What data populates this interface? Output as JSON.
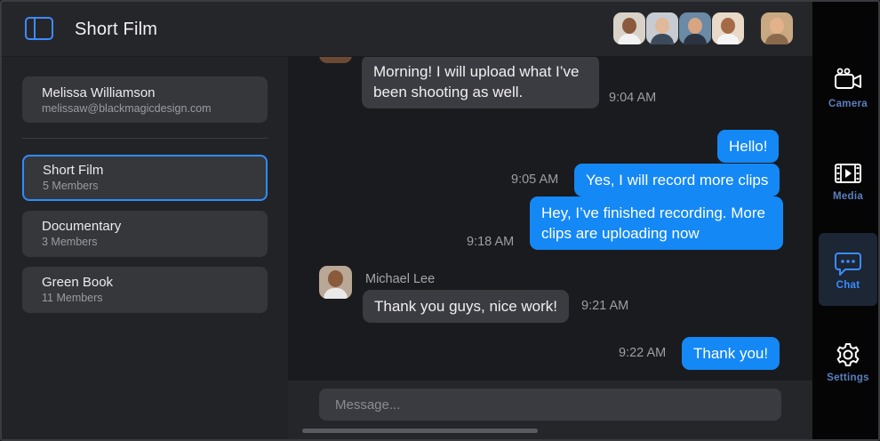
{
  "header": {
    "title": "Short Film",
    "participants": [
      {
        "name": "participant-1",
        "skin": "#8a5a3c",
        "shirt": "#f2f2f2",
        "bg": "#d9d2c9"
      },
      {
        "name": "participant-2",
        "skin": "#e0b89a",
        "shirt": "#3d4a5c",
        "bg": "#c7ccd3"
      },
      {
        "name": "participant-3",
        "skin": "#d7a582",
        "shirt": "#2a3342",
        "bg": "#6a8aa6"
      },
      {
        "name": "participant-4",
        "skin": "#a56a46",
        "shirt": "#f5f5f5",
        "bg": "#e8d9c8"
      }
    ],
    "self_avatar": {
      "skin": "#e3b28c",
      "shirt": "#8a6a4a",
      "bg": "#c9a982"
    }
  },
  "user": {
    "name": "Melissa Williamson",
    "email": "melissaw@blackmagicdesign.com"
  },
  "groups": [
    {
      "name": "Short Film",
      "members": "5 Members",
      "active": true
    },
    {
      "name": "Documentary",
      "members": "3 Members",
      "active": false
    },
    {
      "name": "Green Book",
      "members": "11 Members",
      "active": false
    }
  ],
  "messages": [
    {
      "text": "Morning! I will upload what I’ve been shooting as well.",
      "time": "9:04 AM",
      "dir": "in"
    },
    {
      "text": "Hello!",
      "time": "",
      "dir": "out"
    },
    {
      "text": "Yes, I will record more clips",
      "time": "9:05 AM",
      "dir": "out"
    },
    {
      "text": "Hey, I’ve finished recording. More clips are uploading now",
      "time": "9:18 AM",
      "dir": "out"
    },
    {
      "sender": "Michael Lee",
      "text": "Thank you guys, nice work!",
      "time": "9:21 AM",
      "dir": "in"
    },
    {
      "text": "Thank you!",
      "time": "9:22 AM",
      "dir": "out"
    }
  ],
  "composer": {
    "placeholder": "Message..."
  },
  "nav": [
    {
      "label": "Camera",
      "icon": "camera-icon",
      "active": false
    },
    {
      "label": "Media",
      "icon": "film-icon",
      "active": false
    },
    {
      "label": "Chat",
      "icon": "chat-icon",
      "active": true
    },
    {
      "label": "Settings",
      "icon": "gear-icon",
      "active": false
    }
  ],
  "colors": {
    "accent": "#1488f5",
    "nav_label": "#5b7fbe",
    "nav_active_bg": "#1c2635"
  }
}
